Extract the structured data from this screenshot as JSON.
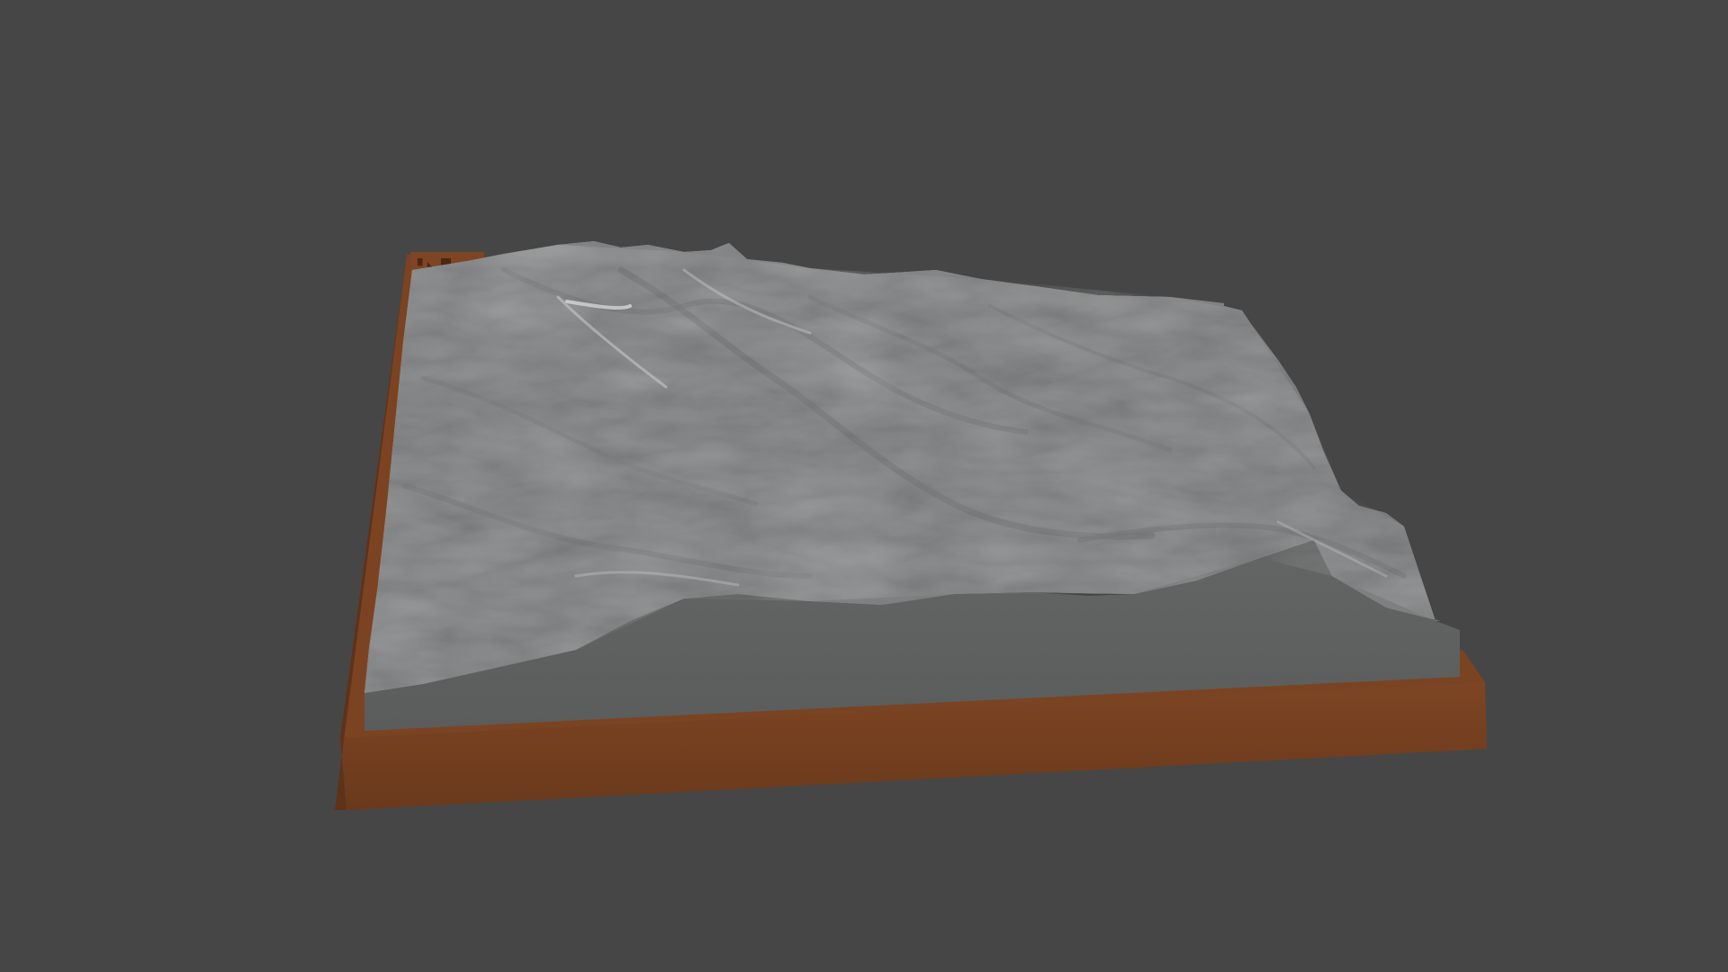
{
  "viewport": {
    "background": "#464646"
  },
  "model": {
    "subject": "3d-terrain-relief-model",
    "terrain_color": "#8f9091",
    "terrain_side_color": "#5f6060",
    "base_color": "#7a4322",
    "base_dark_color": "#5b3118"
  }
}
